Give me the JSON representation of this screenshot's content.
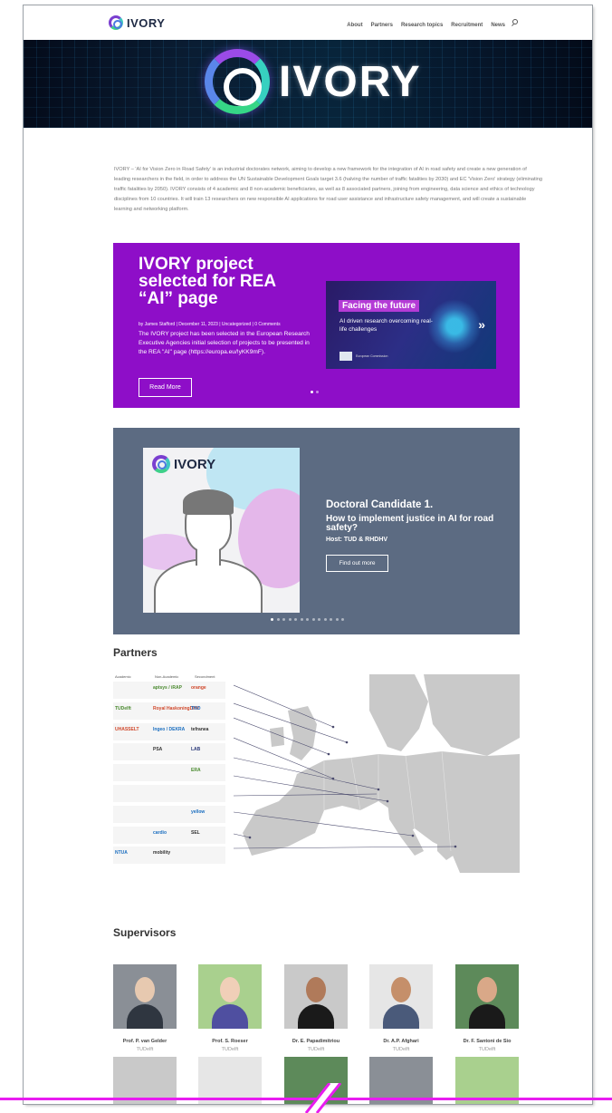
{
  "header": {
    "logo_text": "IVORY",
    "nav": [
      "About",
      "Partners",
      "Research topics",
      "Recruitment",
      "News"
    ]
  },
  "hero": {
    "logo_text": "IVORY"
  },
  "intro": {
    "text": "IVORY – 'AI for Vision Zero in Road Safety' is an industrial doctorates network, aiming to develop a new framework for the integration of AI in road safety and create a new generation of leading researchers in the field, in order to address the UN Sustainable Development Goals target 3.6 (halving the number of traffic fatalities by 2030) and EC 'Vision Zero' strategy (eliminating traffic fatalities by 2050). IVORY consists of 4 academic and 8 non-academic beneficiaries, as well as 8 associated partners, joining from engineering, data science and ethics of technology disciplines from 10 countries. It will train 13 researchers on new responsible AI applications for road user assistance and infrastructure safety management, and will create a sustainable learning and networking platform."
  },
  "promo": {
    "title": "IVORY project selected for REA “AI” page",
    "meta": "by James Stafford | December 11, 2023 | Uncategorized | 0 Comments",
    "body": "The IVORY project has been selected in the European Research Executive Agencies initial selection of projects to be presented in the REA \"AI\" page (https://europa.eu/!yKK9mF).",
    "button": "Read More",
    "card_title": "Facing the future",
    "card_subtitle": "AI driven research overcoming real-life challenges",
    "card_eu": "European Commission",
    "dots": 2,
    "active_dot": 0
  },
  "doctoral": {
    "logo_text": "IVORY",
    "title": "Doctoral Candidate 1.",
    "question": "How to implement justice in AI for road safety?",
    "host": "Host: TUD & RHDHV",
    "button": "Find out more",
    "dots": 13,
    "active_dot": 0
  },
  "partners": {
    "title": "Partners",
    "columns": [
      "Academic",
      "Non-Academic",
      "Secondment"
    ],
    "logos": [
      [
        "",
        "aptsys / iRAP",
        "orange"
      ],
      [
        "TUDelft",
        "Royal HaskoningDHV",
        "TNO"
      ],
      [
        "UHASSELT",
        "Ingeo / DEKRA",
        "tefranea"
      ],
      [
        "",
        "PSA",
        "LAB"
      ],
      [
        "",
        "",
        "ERA"
      ],
      [
        "",
        "",
        ""
      ],
      [
        "",
        "",
        "yellow"
      ],
      [
        "",
        "cardio",
        "SEL"
      ],
      [
        "NTUA",
        "mobility",
        ""
      ]
    ]
  },
  "supervisors": {
    "title": "Supervisors",
    "people": [
      {
        "name": "Prof. P. van Gelder",
        "org": "TUDelft"
      },
      {
        "name": "Prof. S. Roeser",
        "org": "TUDelft"
      },
      {
        "name": "Dr. E. Papadimitriou",
        "org": "TUDelft"
      },
      {
        "name": "Dr. A.P. Afghari",
        "org": "TUDelft"
      },
      {
        "name": "Dr. F. Santoni de Sio",
        "org": "TUDelft"
      }
    ]
  },
  "colors": {
    "promo_bg": "#8e0ec8",
    "doctoral_bg": "#5c6b82",
    "accent_line": "#e81cf0"
  }
}
